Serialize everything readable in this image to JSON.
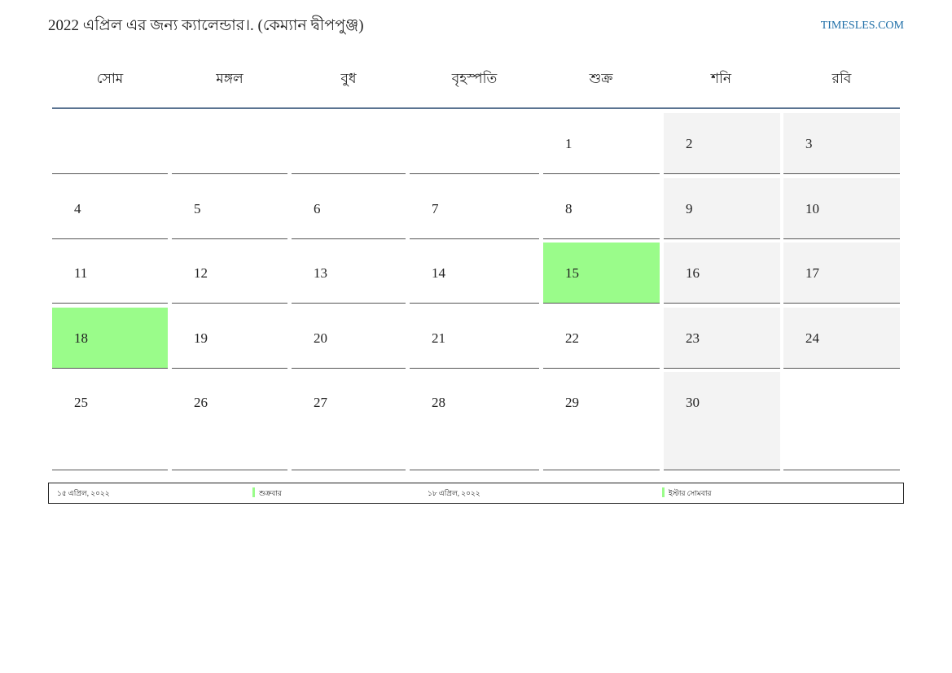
{
  "header": {
    "title": "2022 এপ্রিল এর জন্য ক্যালেন্ডার।. (কেম্যান দ্বীপপুঞ্জ)",
    "site": "TIMESLES.COM",
    "link_color": "#1f6fa8"
  },
  "weekdays": [
    "সোম",
    "মঙ্গল",
    "বুধ",
    "বৃহস্পতি",
    "শুক্র",
    "শনি",
    "রবি"
  ],
  "weeks": [
    [
      "",
      "",
      "",
      "",
      "1",
      "2",
      "3"
    ],
    [
      "4",
      "5",
      "6",
      "7",
      "8",
      "9",
      "10"
    ],
    [
      "11",
      "12",
      "13",
      "14",
      "15",
      "16",
      "17"
    ],
    [
      "18",
      "19",
      "20",
      "21",
      "22",
      "23",
      "24"
    ],
    [
      "25",
      "26",
      "27",
      "28",
      "29",
      "30",
      ""
    ]
  ],
  "holidays": [
    "15",
    "18"
  ],
  "colors": {
    "holiday": "#9afc8a",
    "weekend": "#f3f3f3",
    "header_rule": "#5a7391"
  },
  "legend": [
    {
      "date": "১৫ এপ্রিল, ২০২২",
      "name": "শুক্রবার"
    },
    {
      "date": "১৮ এপ্রিল, ২০২২",
      "name": "ইস্টার সোমবার"
    }
  ]
}
